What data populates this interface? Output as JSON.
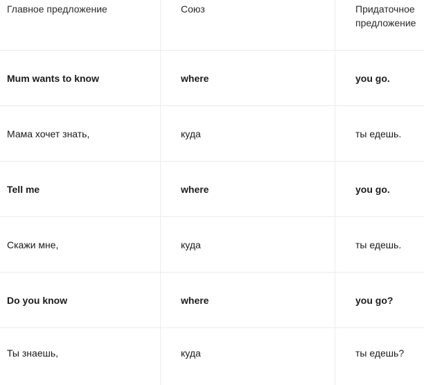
{
  "table": {
    "headers": [
      "Главное предложение",
      "Союз",
      "Придаточное предложение"
    ],
    "rows": [
      [
        "Mum wants to know",
        "where",
        "you go."
      ],
      [
        "Мама хочет знать,",
        "куда",
        "ты едешь."
      ],
      [
        "Tell me",
        "where",
        "you go."
      ],
      [
        "Скажи мне,",
        "куда",
        "ты едешь."
      ],
      [
        "Do you know",
        "where",
        "you go?"
      ],
      [
        "Ты знаешь,",
        "куда",
        "ты едешь?"
      ]
    ]
  }
}
